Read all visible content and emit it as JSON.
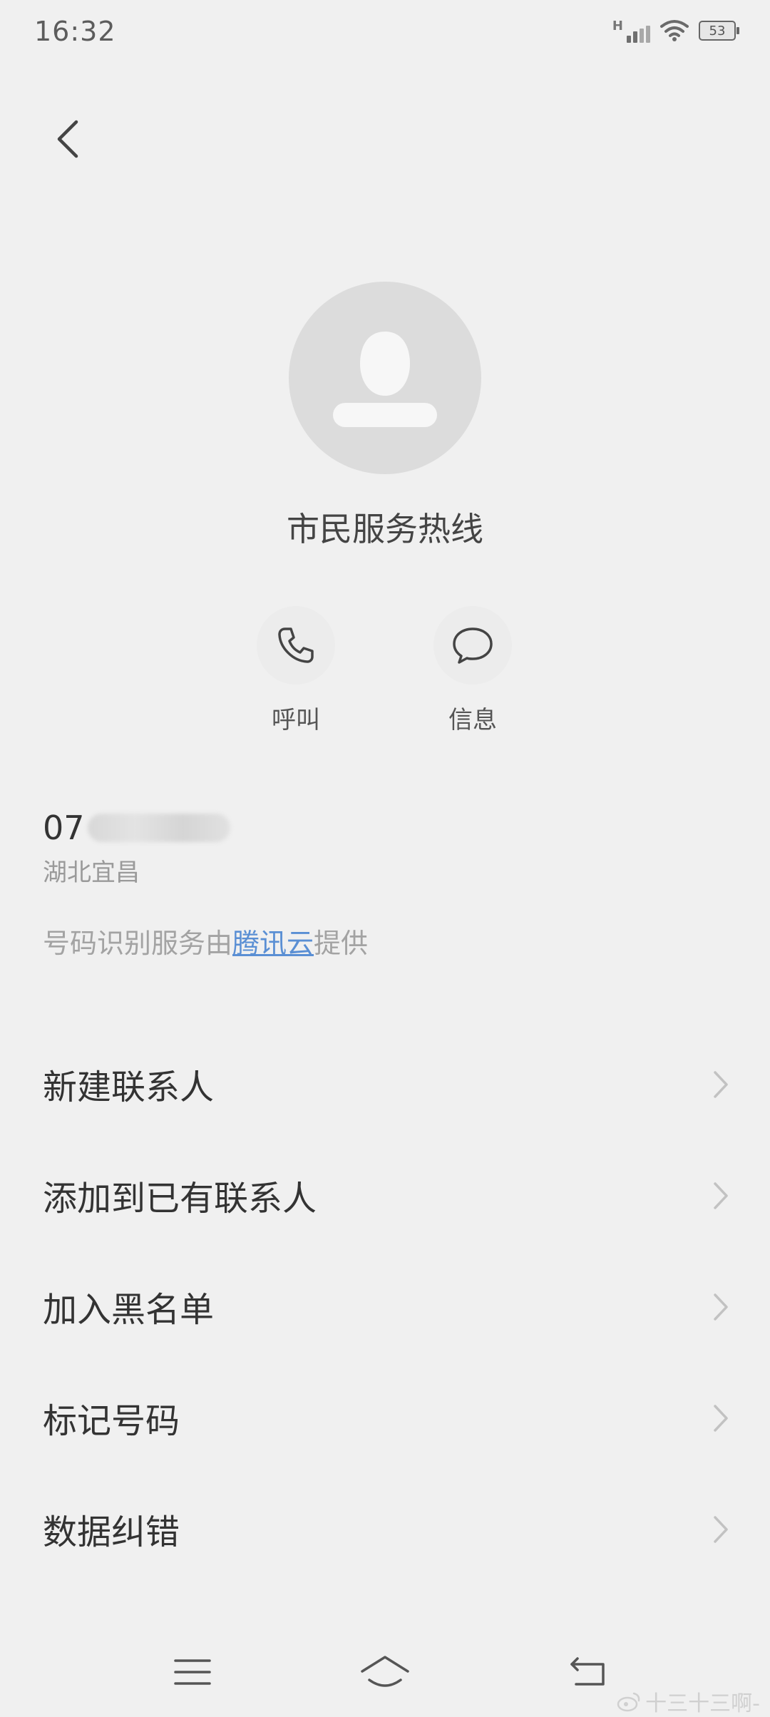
{
  "status_bar": {
    "time": "16:32",
    "network_label": "H",
    "battery": "53",
    "icons": [
      "signal-icon",
      "wifi-icon",
      "battery-icon"
    ]
  },
  "contact": {
    "name": "市民服务热线",
    "number_visible": "07",
    "location": "湖北宜昌"
  },
  "actions": [
    {
      "label": "呼叫",
      "icon": "phone-icon"
    },
    {
      "label": "信息",
      "icon": "message-icon"
    }
  ],
  "provider": {
    "prefix": "号码识别服务由",
    "link": "腾讯云",
    "suffix": "提供"
  },
  "menu": [
    {
      "label": "新建联系人"
    },
    {
      "label": "添加到已有联系人"
    },
    {
      "label": "加入黑名单"
    },
    {
      "label": "标记号码"
    },
    {
      "label": "数据纠错"
    }
  ],
  "watermark": "十三十三啊-",
  "colors": {
    "background": "#f0f0f0",
    "link": "#5a8fd4",
    "avatar": "#dcdcdc"
  }
}
